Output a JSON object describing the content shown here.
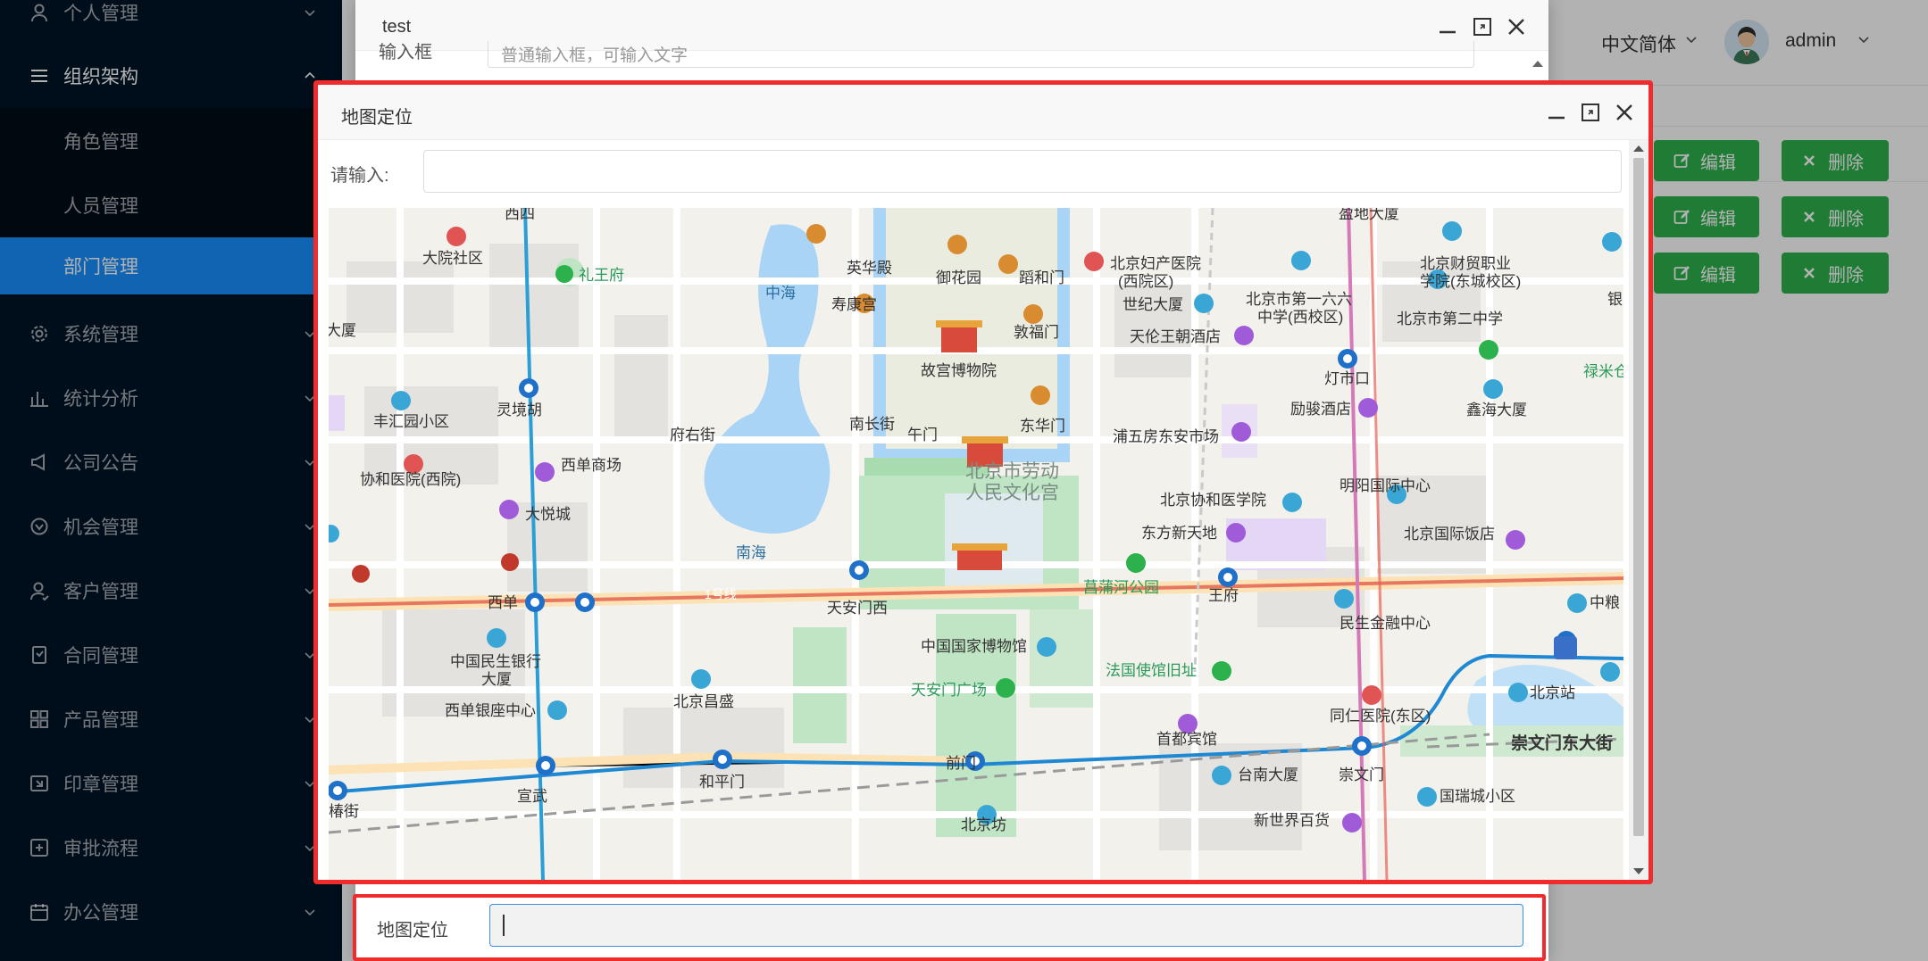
{
  "sidebar": {
    "items": [
      {
        "label": "个人管理",
        "icon": "user-icon"
      },
      {
        "label": "组织架构",
        "icon": "menu-icon"
      },
      {
        "label": "系统管理",
        "icon": "gear-icon"
      },
      {
        "label": "统计分析",
        "icon": "bar-chart-icon"
      },
      {
        "label": "公司公告",
        "icon": "megaphone-icon"
      },
      {
        "label": "机会管理",
        "icon": "opportunity-icon"
      },
      {
        "label": "客户管理",
        "icon": "customer-icon"
      },
      {
        "label": "合同管理",
        "icon": "contract-icon"
      },
      {
        "label": "产品管理",
        "icon": "grid-icon"
      },
      {
        "label": "印章管理",
        "icon": "seal-icon"
      },
      {
        "label": "审批流程",
        "icon": "approval-icon"
      },
      {
        "label": "办公管理",
        "icon": "calendar-icon"
      }
    ],
    "sub_items": [
      {
        "label": "角色管理"
      },
      {
        "label": "人员管理"
      },
      {
        "label": "部门管理",
        "active": true
      }
    ]
  },
  "header": {
    "language": "中文简体",
    "username": "admin"
  },
  "table_actions": {
    "edit_label": "编辑",
    "delete_label": "删除"
  },
  "form_modal": {
    "title": "test",
    "row1_label": "输入框",
    "row1_placeholder": "普通输入框，可输入文字",
    "bottom_label": "地图定位"
  },
  "map_modal": {
    "title": "地图定位",
    "search_label": "请输入:",
    "search_value": ""
  },
  "map": {
    "labels": [
      "西四",
      "大院社区",
      "礼王府",
      "中海",
      "英华殿",
      "御花园",
      "蹈和门",
      "寿康宫",
      "北京妇产医院",
      "(西院区)",
      "世纪大厦",
      "北京市第一六六",
      "中学(西校区)",
      "北京财贸职业",
      "学院(东城校区)",
      "北京市第二中学",
      "盈地大厦",
      "天伦王朝酒店",
      "故宫博物院",
      "敦福门",
      "灯市口",
      "禄米仓",
      "灵境胡",
      "丰汇园小区",
      "励骏酒店",
      "鑫海大厦",
      "南长街",
      "午门",
      "东华门",
      "府右街",
      "浦五房东安市场",
      "西单商场",
      "北京市劳动",
      "人民文化宫",
      "协和医院(西院)",
      "大悦城",
      "北京协和医学院",
      "明阳国际中心",
      "东方新天地",
      "北京国际饭店",
      "南海",
      "菖蒲河公园",
      "王府",
      "西单",
      "1号线",
      "天安门西",
      "民生金融中心",
      "中国国家博物馆",
      "中国民生银行",
      "大厦",
      "法国使馆旧址",
      "北京站",
      "天安门广场",
      "北京昌盛",
      "西单银座中心",
      "同仁医院(东区)",
      "崇文门东大街",
      "首都宾馆",
      "和平门",
      "宣武",
      "前门",
      "台南大厦",
      "崇文门",
      "国瑞城小区",
      "北京坊",
      "新世界百货",
      "椿街",
      "东大厦",
      "中粮",
      "银"
    ]
  }
}
